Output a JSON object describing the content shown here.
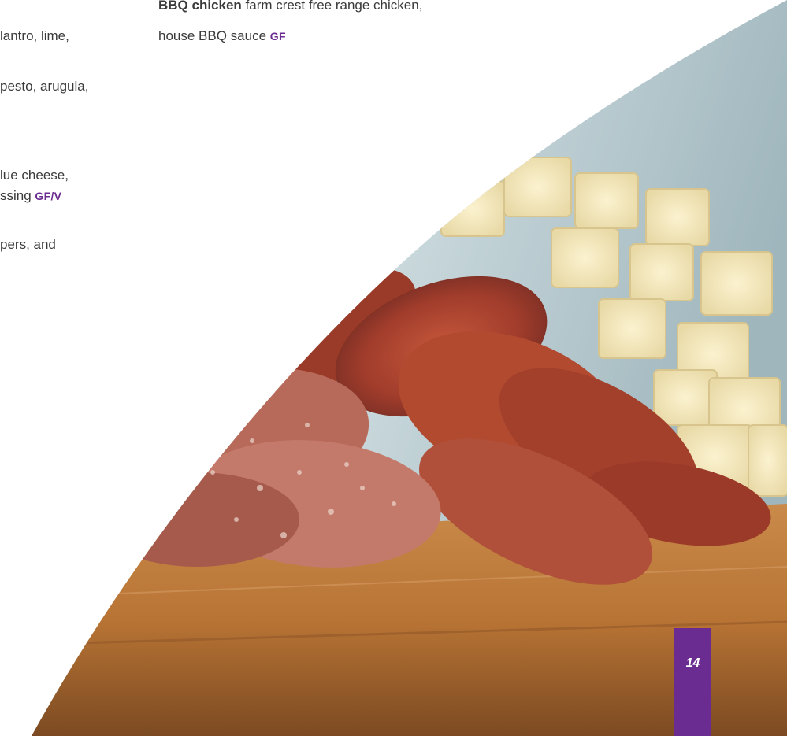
{
  "menu": {
    "left_column": [
      {
        "text": "lantro, lime,"
      },
      {
        "text": "pesto, arugula,"
      },
      {
        "text": "lue cheese,"
      },
      {
        "text": "ssing",
        "tag": "GF/V"
      },
      {
        "text": "pers, and"
      }
    ],
    "right_column": {
      "item_name": "BBQ chicken",
      "description_line1": "farm crest free range chicken,",
      "description_line2": "house BBQ sauce",
      "tag": "GF"
    }
  },
  "photo": {
    "subject": "charcuterie board with sliced cured meats and cubed cheese on wooden board"
  },
  "page": {
    "number": "14"
  },
  "colors": {
    "accent": "#6a2c91"
  }
}
